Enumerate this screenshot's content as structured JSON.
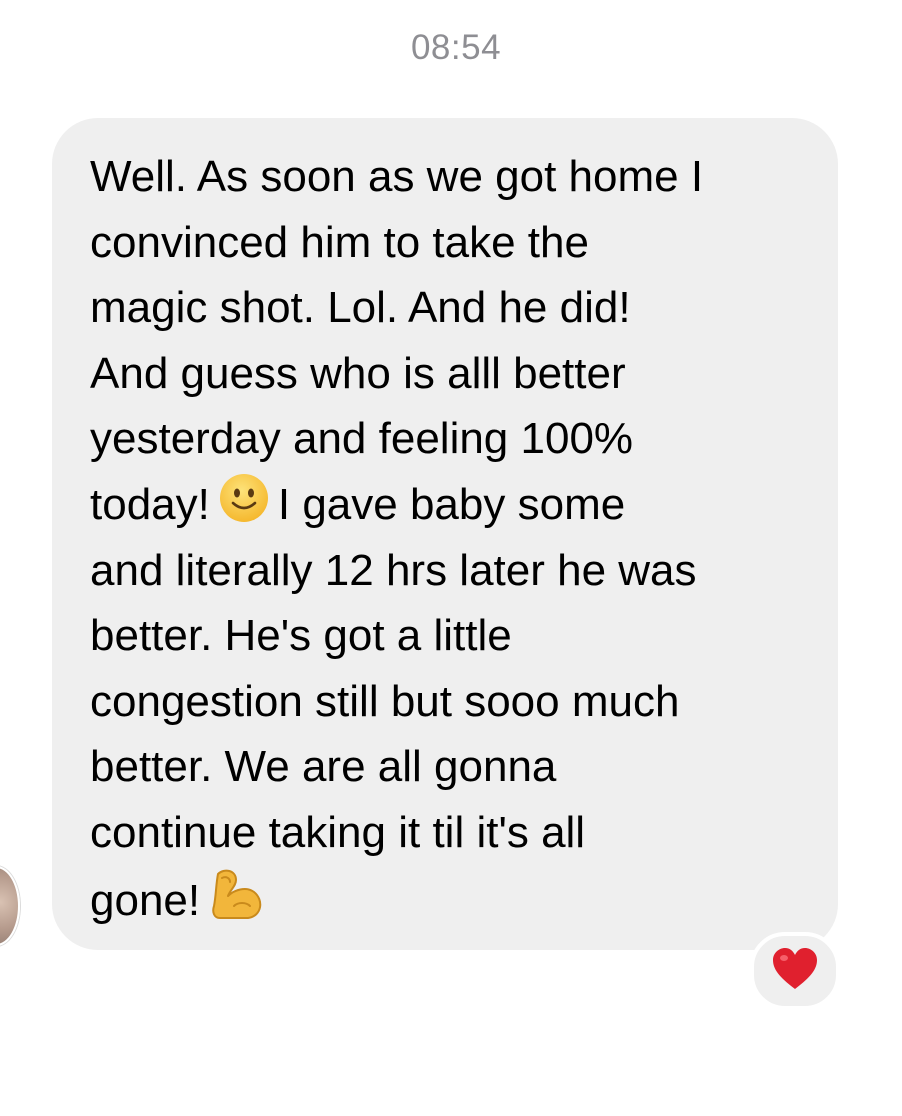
{
  "conversation": {
    "timestamp": "08:54"
  },
  "message": {
    "lines": [
      "Well. As soon as we got home I",
      "convinced him to take the",
      "magic shot. Lol. And he did!",
      "And guess who is alll better",
      "yesterday and feeling 100%",
      "today!",
      "I gave baby some",
      "and literally 12 hrs later he was",
      "better. He's got a little",
      "congestion still but sooo much",
      "better. We are all gonna",
      "continue taking it til it's all",
      "gone!"
    ],
    "emojis": [
      "slightly-smiling-face",
      "flexed-biceps"
    ],
    "reaction": "heart"
  },
  "colors": {
    "bubble": "#efefef",
    "timestamp": "#8e8e93",
    "text": "#000000",
    "heart": "#e0202e",
    "smiley": "#f7c33a",
    "biceps": "#f0b43a"
  }
}
